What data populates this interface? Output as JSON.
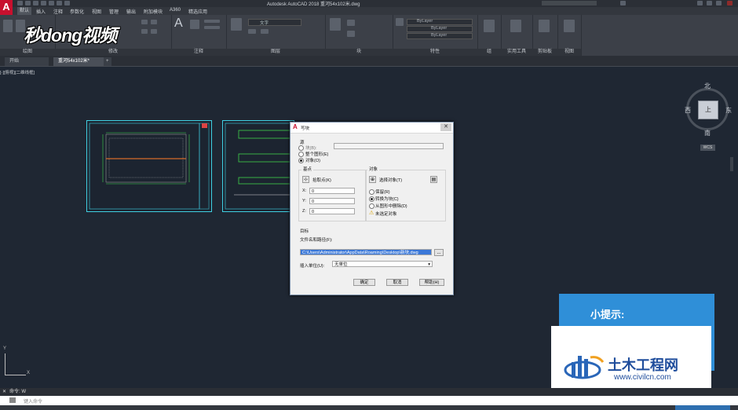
{
  "title": "Autodesk AutoCAD 2018    重河54x102米.dwg",
  "app_logo": "A",
  "watermark": "秒dong视频",
  "menu": [
    "默认",
    "插入",
    "注释",
    "参数化",
    "视图",
    "管理",
    "输出",
    "附加模块",
    "A360",
    "精选应用"
  ],
  "ribbon": {
    "panels": [
      "绘图",
      "修改",
      "注释",
      "图层",
      "块",
      "特性",
      "组",
      "实用工具",
      "剪贴板",
      "视图"
    ],
    "text_tool": "A",
    "layer_name": "文字",
    "props": [
      "ByLayer",
      "ByLayer",
      "ByLayer"
    ],
    "color_label": "ByLayer"
  },
  "tabs": [
    "开始",
    "重河54x102米*",
    "+"
  ],
  "viewport_label": "[-][俯视][二维线框]",
  "viewcube": {
    "north": "北",
    "south": "南",
    "east": "东",
    "west": "西",
    "face": "上",
    "wcs": "WCS"
  },
  "dialog": {
    "title": "写块",
    "source_label": "源",
    "source_options": [
      "块(B):",
      "整个图形(E)",
      "对象(O)"
    ],
    "base_point": "基点",
    "pick_point": "拾取点(K)",
    "coords": [
      {
        "label": "X:",
        "value": "0"
      },
      {
        "label": "Y:",
        "value": "0"
      },
      {
        "label": "Z:",
        "value": "0"
      }
    ],
    "objects_label": "对象",
    "select_objects": "选择对象(T)",
    "object_options": [
      "保留(R)",
      "转换为块(C)",
      "从图形中删除(D)"
    ],
    "no_selection": "未选定对象",
    "target_label": "目标",
    "file_path_label": "文件名和路径(F):",
    "file_path": "C:\\Users\\Administrator\\AppData\\Roaming\\Desktop\\新块.dwg",
    "browse": "...",
    "units_label": "插入单位(U):",
    "units": "无单位",
    "ok": "确定",
    "cancel": "取消",
    "help": "帮助(H)"
  },
  "tip": "小提示:",
  "site_logo": {
    "name": "土木工程网",
    "url": "www.civilcn.com"
  },
  "command": {
    "history": "命令: W",
    "prompt": "键入命令"
  }
}
